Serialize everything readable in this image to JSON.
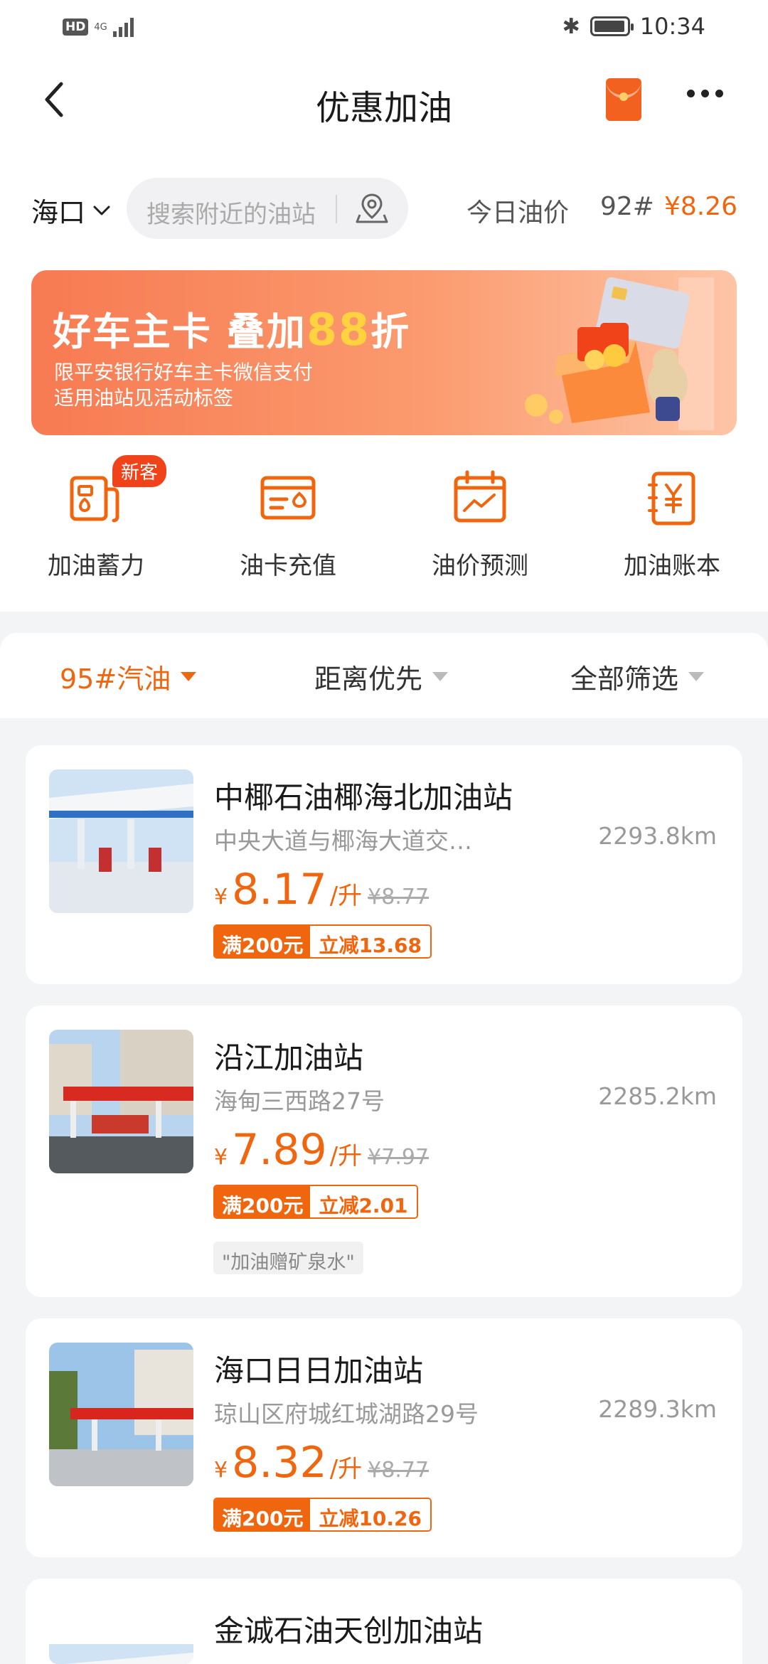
{
  "status_bar": {
    "hd": "HD",
    "network": "4G",
    "time": "10:34"
  },
  "header": {
    "title": "优惠加油"
  },
  "search_row": {
    "city": "海口",
    "search_placeholder": "搜索附近的油站",
    "price_label": "今日油价",
    "fuel_grade": "92#",
    "price_value": "¥8.26"
  },
  "banner": {
    "title_prefix": "好车主卡 叠加",
    "title_highlight": "88",
    "title_suffix": "折",
    "line1": "限平安银行好车主卡微信支付",
    "line2": "适用油站见活动标签"
  },
  "quick_actions": [
    {
      "label": "加油蓄力",
      "badge": "新客",
      "icon": "fuel-pump-icon"
    },
    {
      "label": "油卡充值",
      "icon": "fuel-card-icon"
    },
    {
      "label": "油价预测",
      "icon": "calendar-trend-icon"
    },
    {
      "label": "加油账本",
      "icon": "ledger-yen-icon"
    }
  ],
  "filters": [
    {
      "label": "95#汽油",
      "active": true
    },
    {
      "label": "距离优先",
      "active": false
    },
    {
      "label": "全部筛选",
      "active": false
    }
  ],
  "stations": [
    {
      "name": "中椰石油椰海北加油站",
      "address": "中央大道与椰海大道交…",
      "distance": "2293.8km",
      "yen": "¥",
      "price": "8.17",
      "unit": "/升",
      "original": "¥8.77",
      "promo_threshold": "满200元",
      "promo_discount": "立减13.68"
    },
    {
      "name": "沿江加油站",
      "address": "海甸三西路27号",
      "distance": "2285.2km",
      "yen": "¥",
      "price": "7.89",
      "unit": "/升",
      "original": "¥7.97",
      "promo_threshold": "满200元",
      "promo_discount": "立减2.01",
      "tag": "\"加油赠矿泉水\""
    },
    {
      "name": "海口日日加油站",
      "address": "琼山区府城红城湖路29号",
      "distance": "2289.3km",
      "yen": "¥",
      "price": "8.32",
      "unit": "/升",
      "original": "¥8.77",
      "promo_threshold": "满200元",
      "promo_discount": "立减10.26"
    },
    {
      "name": "金诚石油天创加油站"
    }
  ],
  "colors": {
    "accent": "#f0660f",
    "badge_red": "#f0431a",
    "background": "#f3f4f6"
  }
}
